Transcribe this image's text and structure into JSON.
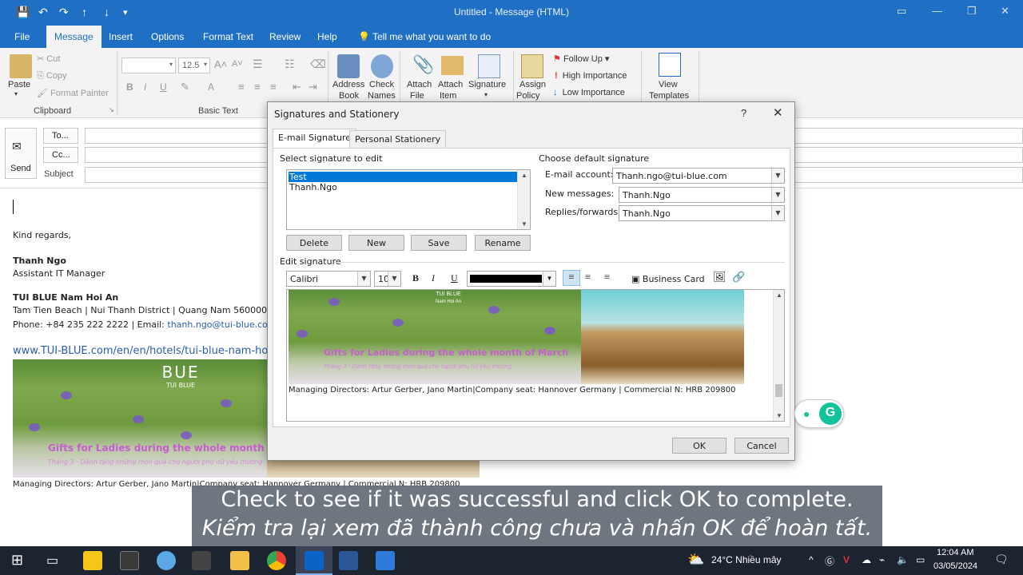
{
  "window": {
    "title": "Untitled  -  Message (HTML)",
    "menu_tabs": [
      "File",
      "Message",
      "Insert",
      "Options",
      "Format Text",
      "Review",
      "Help"
    ],
    "tell_me": "Tell me what you want to do"
  },
  "ribbon": {
    "clipboard": {
      "paste": "Paste",
      "cut": "Cut",
      "copy": "Copy",
      "format_painter": "Format Painter",
      "label": "Clipboard"
    },
    "basic_text": {
      "font_size": "12.5",
      "label": "Basic Text"
    },
    "names": {
      "address_book_1": "Address",
      "address_book_2": "Book",
      "check_names_1": "Check",
      "check_names_2": "Names"
    },
    "include": {
      "attach_file_1": "Attach",
      "attach_file_2": "File",
      "attach_item_1": "Attach",
      "attach_item_2": "Item",
      "signature": "Signature"
    },
    "tags": {
      "assign_policy_1": "Assign",
      "assign_policy_2": "Policy",
      "follow_up": "Follow Up",
      "high": "High Importance",
      "low": "Low Importance"
    },
    "templates": {
      "view_1": "View",
      "view_2": "Templates"
    }
  },
  "compose": {
    "send": "Send",
    "to": "To...",
    "cc": "Cc...",
    "subject": "Subject"
  },
  "body": {
    "kind_regards": "Kind regards,",
    "name": "Thanh Ngo",
    "role": "Assistant IT Manager",
    "company": "TUI BLUE Nam Hoi An",
    "address": "Tam Tien Beach | Nui Thanh District | Quang Nam 560000 | Vi",
    "phone_line": "Phone:  +84 235 222 2222  |  Email:",
    "email": "thanh.ngo@tui-blue.com",
    "website": "www.TUI-BLUE.com/en/en/hotels/tui-blue-nam-ho",
    "banner_title": "Gifts for Ladies during the whole month of Mar",
    "banner_sub": "Tháng 3 - Dành tặng những món quà cho người phụ nữ yêu thương",
    "banner_logo": "BUE",
    "banner_logo_sub": "TUI BLUE",
    "banner_logo_sub2": "Nam Hoi An",
    "footer": "Managing Directors: Artur Gerber, Jano Martin|Company seat: Hannover Germany | Commercial N: HRB 209800"
  },
  "dialog": {
    "title": "Signatures and Stationery",
    "help": "?",
    "close": "✕",
    "tab_email": "E-mail Signature",
    "tab_personal": "Personal Stationery",
    "select_label": "Select signature to edit",
    "signatures": [
      "Test",
      "Thanh.Ngo"
    ],
    "buttons": {
      "delete": "Delete",
      "new": "New",
      "save": "Save",
      "rename": "Rename",
      "ok": "OK",
      "cancel": "Cancel"
    },
    "choose_default": "Choose default signature",
    "email_account_label": "E-mail account:",
    "email_account": "Thanh.ngo@tui-blue.com",
    "new_messages_label": "New messages:",
    "new_messages": "Thanh.Ngo",
    "replies_label": "Replies/forwards:",
    "replies": "Thanh.Ngo",
    "edit_label": "Edit signature",
    "font": "Calibri",
    "size": "10",
    "bold": "B",
    "italic": "I",
    "underline": "U",
    "business_card": "Business Card",
    "editor_banner_title": "Gifts for Ladies during the whole month of March",
    "editor_banner_sub": "Tháng 3 - Dành tặng những món quà cho người phụ nữ yêu thương",
    "editor_logo": "TUI BLUE",
    "editor_logo2": "Nam Hoi An",
    "editor_footer": "Managing Directors: Artur Gerber, Jano Martin|Company seat: Hannover Germany | Commercial N: HRB 209800"
  },
  "caption": {
    "line1": "Check to see if it was successful and click OK to complete.",
    "line2": "Kiểm tra lại xem đã thành công chưa và nhấn OK để hoàn tất."
  },
  "taskbar": {
    "weather": "24°C  Nhiều mây",
    "time": "12:04 AM",
    "date": "03/05/2024"
  },
  "colors": {
    "accent": "#1f6fc5",
    "selection": "#0078d7",
    "caption_bg": "#5a646e",
    "taskbar": "#1c2331"
  }
}
